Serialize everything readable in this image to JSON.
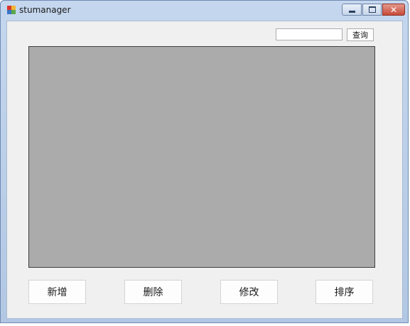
{
  "window": {
    "title": "stumanager",
    "icon": "app-icon",
    "caption_buttons": [
      "minimize-icon",
      "maximize-icon",
      "close-icon"
    ],
    "close_glyph": "✕"
  },
  "search": {
    "value": "",
    "button_label": "查询"
  },
  "data_grid": {
    "columns": [],
    "rows": []
  },
  "actions": {
    "add_label": "新增",
    "delete_label": "删除",
    "edit_label": "修改",
    "sort_label": "排序"
  },
  "colors": {
    "client_bg": "#f0f0f0",
    "grid_bg": "#ababab",
    "close_button": "#c7493a"
  }
}
